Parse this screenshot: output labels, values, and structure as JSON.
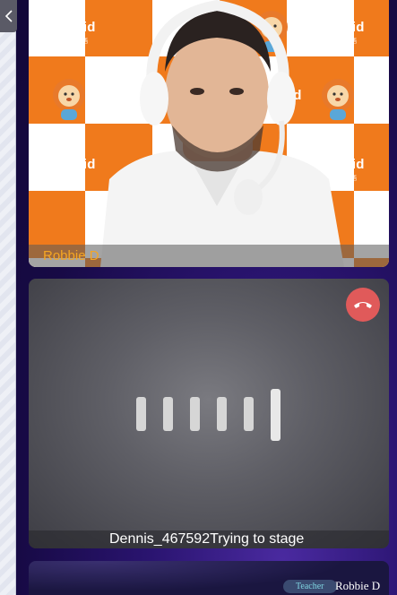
{
  "nav": {
    "back_icon": "chevron-left-icon"
  },
  "video_tile": {
    "brand_text": "BetaKid",
    "brand_subtext": "贝达在线少儿英语",
    "participant_name": "Robbie D"
  },
  "audio_tile": {
    "hangup_icon": "phone-hangup-icon",
    "audio_icon": "audio-level-bars-icon",
    "status_text": "Dennis_467592Trying to stage"
  },
  "third_tile": {
    "role_badge": "Teacher",
    "participant_name": "Robbie D"
  },
  "colors": {
    "brand_orange": "#f07a1c",
    "name_label": "#f5a623",
    "hangup_red": "#e05a5a",
    "background_purple": "#1c0f4a"
  }
}
